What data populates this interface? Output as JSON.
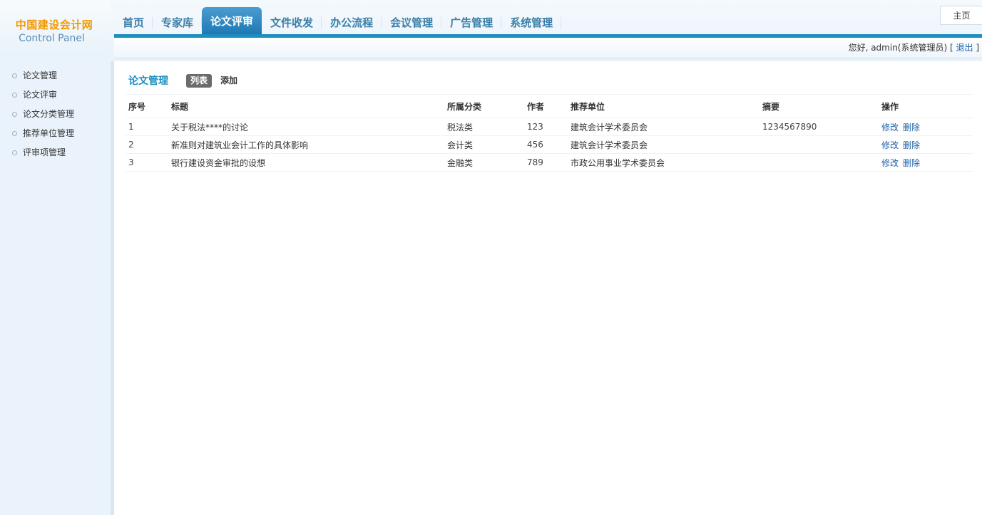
{
  "logo": {
    "cn": "中国建设会计网",
    "en": "Control Panel"
  },
  "nav": [
    {
      "label": "首页",
      "active": false
    },
    {
      "label": "专家库",
      "active": false
    },
    {
      "label": "论文评审",
      "active": true
    },
    {
      "label": "文件收发",
      "active": false
    },
    {
      "label": "办公流程",
      "active": false
    },
    {
      "label": "会议管理",
      "active": false
    },
    {
      "label": "广告管理",
      "active": false
    },
    {
      "label": "系统管理",
      "active": false
    }
  ],
  "home_button": "主页",
  "welcome": {
    "text": "您好, admin(系统管理员) [ ",
    "logout": "退出",
    "close": " ]"
  },
  "sidebar": {
    "items": [
      {
        "label": "论文管理"
      },
      {
        "label": "论文评审"
      },
      {
        "label": "论文分类管理"
      },
      {
        "label": "推荐单位管理"
      },
      {
        "label": "评审项管理"
      }
    ]
  },
  "main": {
    "title": "论文管理",
    "tab_list": "列表",
    "tab_add": "添加",
    "columns": [
      "序号",
      "标题",
      "所属分类",
      "作者",
      "推荐单位",
      "摘要",
      "操作"
    ],
    "rows": [
      {
        "no": "1",
        "title": "关于税法****的讨论",
        "category": "税法类",
        "author": "123",
        "unit": "建筑会计学术委员会",
        "abstract": "1234567890",
        "edit": "修改",
        "delete": "删除"
      },
      {
        "no": "2",
        "title": "新准则对建筑业会计工作的具体影响",
        "category": "会计类",
        "author": "456",
        "unit": "建筑会计学术委员会",
        "abstract": "",
        "edit": "修改",
        "delete": "删除"
      },
      {
        "no": "3",
        "title": "银行建设资金审批的设想",
        "category": "金融类",
        "author": "789",
        "unit": "市政公用事业学术委员会",
        "abstract": "",
        "edit": "修改",
        "delete": "删除"
      }
    ]
  }
}
